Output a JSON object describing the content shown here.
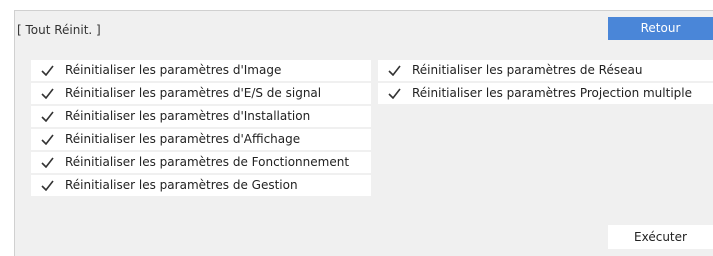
{
  "dialog": {
    "title": "[ Tout Réinit. ]",
    "back_label": "Retour",
    "execute_label": "Exécuter"
  },
  "options_left": [
    {
      "label": "Réinitialiser les paramètres d'Image",
      "checked": true
    },
    {
      "label": "Réinitialiser les paramètres d'E/S de signal",
      "checked": true
    },
    {
      "label": "Réinitialiser les paramètres d'Installation",
      "checked": true
    },
    {
      "label": "Réinitialiser les paramètres d'Affichage",
      "checked": true
    },
    {
      "label": "Réinitialiser les paramètres de Fonctionnement",
      "checked": true
    },
    {
      "label": "Réinitialiser les paramètres de Gestion",
      "checked": true
    }
  ],
  "options_right": [
    {
      "label": "Réinitialiser les paramètres de Réseau",
      "checked": true
    },
    {
      "label": "Réinitialiser les paramètres Projection multiple",
      "checked": true
    }
  ],
  "colors": {
    "accent": "#4a86d8",
    "panel_bg": "#f0f0f0"
  }
}
